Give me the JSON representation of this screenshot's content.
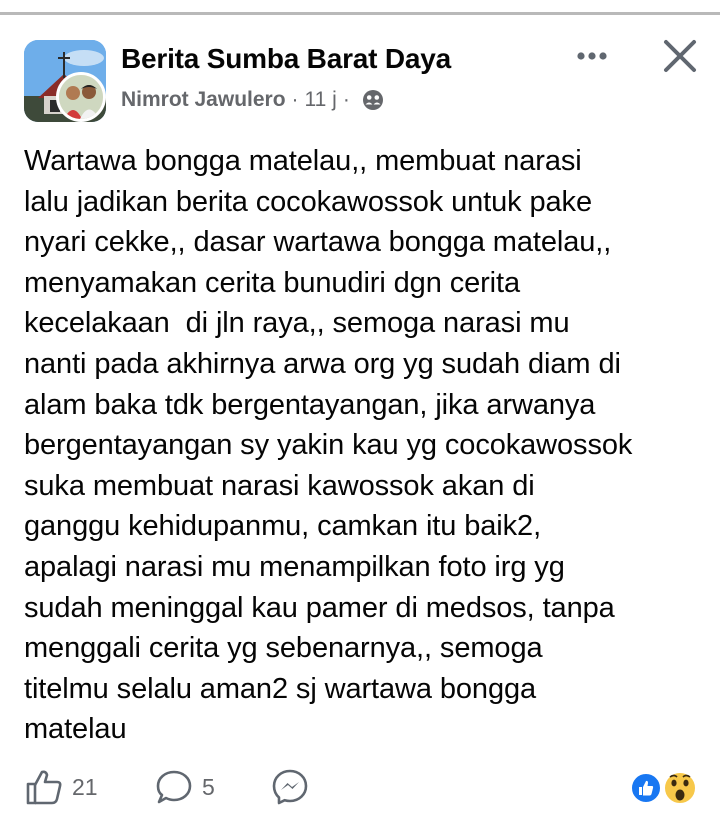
{
  "post": {
    "group_name": "Berita Sumba Barat Daya",
    "author": "Nimrot Jawulero",
    "time": "11 j",
    "separator": "·",
    "privacy_icon": "friends-icon",
    "text_lines": [
      "Wartawa bongga matelau,, membuat narasi",
      "lalu jadikan berita cocokawossok untuk pake",
      "nyari cekke,, dasar wartawa bongga matelau,,",
      "menyamakan cerita bunudiri dgn cerita",
      "kecelakaan  di jln raya,, semoga narasi mu",
      "nanti pada akhirnya arwa org yg sudah diam di",
      "alam baka tdk bergentayangan, jika arwanya",
      "bergentayangan sy yakin kau yg cocokawossok",
      "suka membuat narasi kawossok akan di",
      "ganggu kehidupanmu, camkan itu baik2,",
      "apalagi narasi mu menampilkan foto irg yg",
      "sudah meninggal kau pamer di medsos, tanpa",
      "menggali cerita yg sebenarnya,, semoga",
      "titelmu selalu aman2 sj wartawa bongga",
      "matelau"
    ]
  },
  "actions": {
    "like_count": "21",
    "comment_count": "5",
    "like_icon": "thumbs-up-icon",
    "comment_icon": "comment-bubble-icon",
    "share_icon": "messenger-icon",
    "reactions": [
      "like-reaction",
      "wow-reaction"
    ]
  },
  "colors": {
    "text": "#050505",
    "secondary": "#65676b",
    "icon": "#606770",
    "facebook_blue": "#1877f2",
    "wow_yellow": "#f7c84a"
  }
}
